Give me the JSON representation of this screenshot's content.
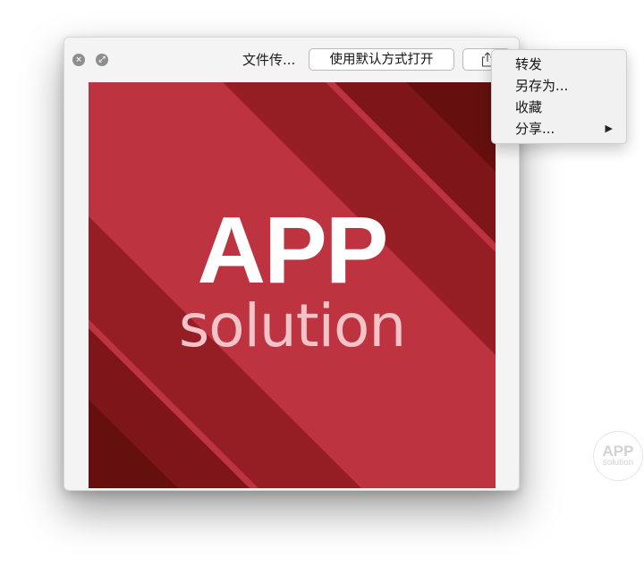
{
  "window": {
    "title": "文件传...",
    "open_button_label": "使用默认方式打开",
    "close_glyph": "×",
    "fullscreen_glyph": "⤢"
  },
  "share_menu": {
    "items": [
      {
        "label": "转发"
      },
      {
        "label": "另存为..."
      },
      {
        "label": "收藏"
      },
      {
        "label": "分享...",
        "submenu_arrow": "▶"
      }
    ]
  },
  "preview_image": {
    "logo_text_main": "APP",
    "logo_text_sub": "solution",
    "colors": {
      "background": "#be3340",
      "stripe_dark": "#8c1b20",
      "stripe_darkest": "#6a0f12",
      "logo_main": "#ffffff",
      "logo_sub": "#f2c4c8"
    }
  },
  "watermark": {
    "text_main": "APP",
    "text_sub": "solution"
  },
  "icons": {
    "close": "close-icon",
    "fullscreen": "fullscreen-icon",
    "share": "share-icon",
    "submenu": "chevron-right-icon"
  }
}
